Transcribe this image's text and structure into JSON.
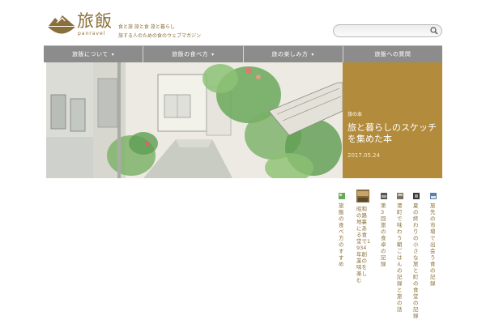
{
  "brand": {
    "logo_text": "旅飯",
    "logo_sub": "panravel",
    "tagline": [
      "食と旅 旅と食 旅と暮らし",
      "旅する人のための食のウェブマガジン"
    ]
  },
  "search": {
    "placeholder": "",
    "value": ""
  },
  "nav": {
    "items": [
      {
        "label": "旅飯について",
        "dropdown": true
      },
      {
        "label": "旅飯の食べ方",
        "dropdown": true
      },
      {
        "label": "旅の楽しみ方",
        "dropdown": true
      },
      {
        "label": "旅飯への質問",
        "dropdown": false
      }
    ],
    "caret": "▾"
  },
  "hero": {
    "category": "旅の本",
    "title": "旅と暮らしのスケッチを集めた本",
    "date": "2017.05.24",
    "panel_color": "#b28c3c"
  },
  "posts": [
    {
      "title": "旅飯の食べ方のすすめ"
    },
    {
      "title": "昭和の路地裏にある食堂で1934年創業の味を楽しむ"
    },
    {
      "title": "第3回旅の食卓の記録"
    },
    {
      "title": "港町で味わう朝ごはんの記録と旅の話"
    },
    {
      "title": "夏の終わりの小さな旅と町の食堂の記録"
    },
    {
      "title": "旅先の市場で出会う食の記録"
    }
  ],
  "colors": {
    "accent": "#b28c3c",
    "nav": "#8c8c8c",
    "brand_text": "#8a6f3a"
  }
}
